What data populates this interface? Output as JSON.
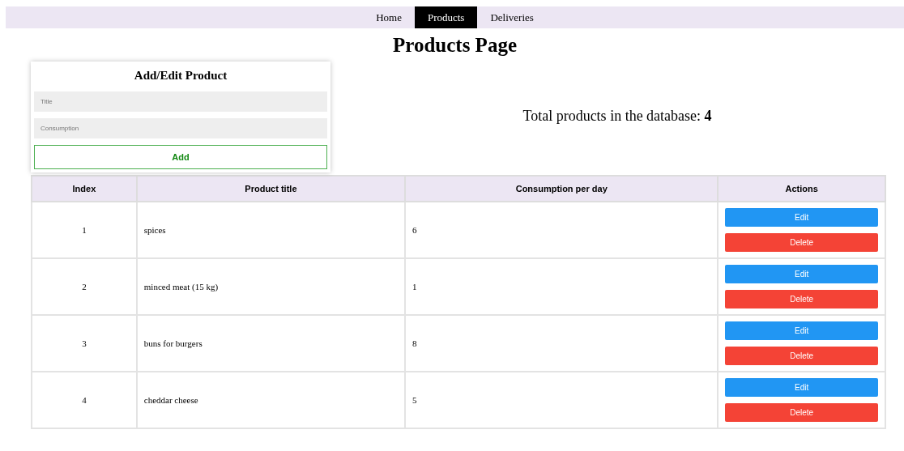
{
  "nav": [
    {
      "label": "Home",
      "selected": false
    },
    {
      "label": "Products",
      "selected": true
    },
    {
      "label": "Deliveries",
      "selected": false
    }
  ],
  "page_title": "Products Page",
  "form": {
    "title": "Add/Edit Product",
    "fields": [
      {
        "placeholder": "Title"
      },
      {
        "placeholder": "Consumption"
      }
    ],
    "submit": "Add"
  },
  "total": "Total products in the database: **4**",
  "table": {
    "columns": [
      "Index",
      "Product title",
      "Consumption per day",
      "Actions"
    ],
    "rows": [
      {
        "index": "1",
        "title": "spices",
        "consumption": "6",
        "actions": [
          "Edit",
          "Delete"
        ]
      },
      {
        "index": "2",
        "title": "minced meat (15 kg)",
        "consumption": "1",
        "actions": [
          "Edit",
          "Delete"
        ]
      },
      {
        "index": "3",
        "title": "buns for burgers",
        "consumption": "8",
        "actions": [
          "Edit",
          "Delete"
        ]
      },
      {
        "index": "4",
        "title": "cheddar cheese",
        "consumption": "5",
        "actions": [
          "Edit",
          "Delete"
        ]
      }
    ]
  }
}
